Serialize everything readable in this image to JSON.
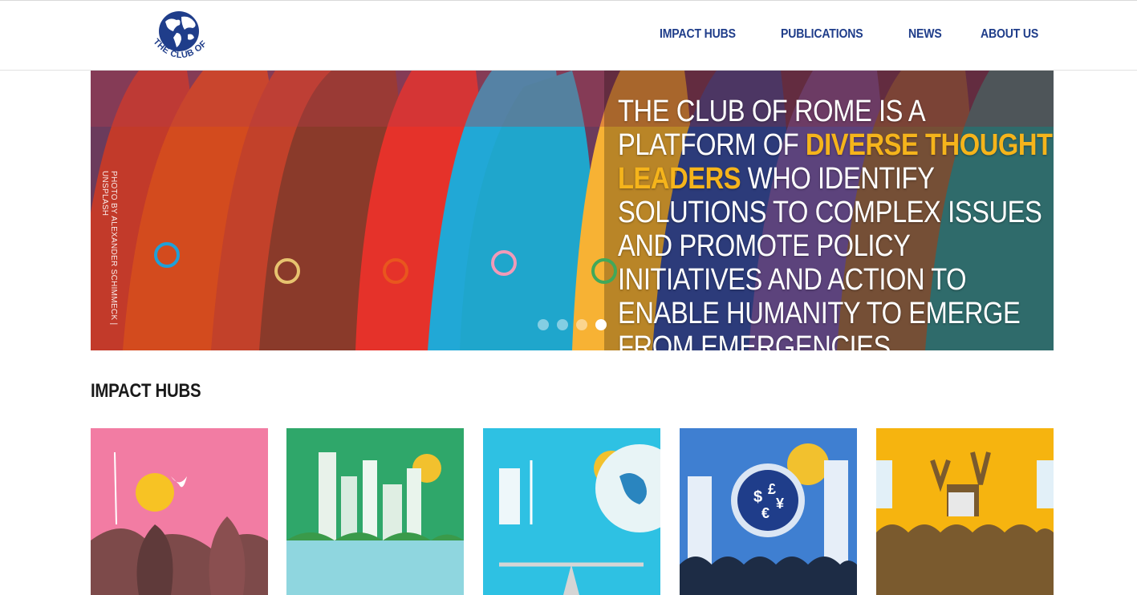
{
  "header": {
    "logo_text": "THE CLUB OF ROME",
    "nav": [
      {
        "label": "IMPACT HUBS"
      },
      {
        "label": "PUBLICATIONS"
      },
      {
        "label": "NEWS"
      },
      {
        "label": "ABOUT US"
      }
    ]
  },
  "hero": {
    "credit": "PHOTO BY ALEXANDER SCHIMMECK | UNSPLASH",
    "headline_part1": "THE CLUB OF ROME IS A PLATFORM OF ",
    "headline_highlight": "DIVERSE THOUGHT LEADERS",
    "headline_part2": " WHO IDENTIFY SOLUTIONS TO COMPLEX ISSUES AND PROMOTE POLICY INITIATIVES AND ACTION TO ENABLE HUMANITY TO EMERGE FROM EMERGENCIES.",
    "slides": 4,
    "active_slide": 4
  },
  "impact_hubs": {
    "title": "IMPACT HUBS",
    "cards": [
      {
        "name": "hub-card-1",
        "bg": "#f27ca3"
      },
      {
        "name": "hub-card-2",
        "bg": "#2fa76a"
      },
      {
        "name": "hub-card-3",
        "bg": "#2ec1e3"
      },
      {
        "name": "hub-card-4",
        "bg": "#3f7fd1"
      },
      {
        "name": "hub-card-5",
        "bg": "#f6b40f"
      }
    ]
  },
  "colors": {
    "nav": "#1f3d8a",
    "highlight": "#f5b41b"
  }
}
